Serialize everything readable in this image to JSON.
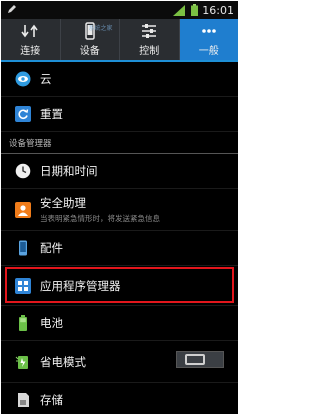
{
  "status": {
    "time": "16:01",
    "icons": [
      "edit-icon",
      "signal-icon",
      "battery-icon"
    ]
  },
  "tabs": [
    {
      "label": "连接",
      "icon": "swap-arrows-icon"
    },
    {
      "label": "设备",
      "icon": "phone-icon",
      "watermark": "系统之家"
    },
    {
      "label": "控制",
      "icon": "sliders-icon"
    },
    {
      "label": "一般",
      "icon": "more-dots-icon",
      "active": true
    }
  ],
  "accent": "#1f7ecf",
  "highlight_color": "#e2161c",
  "list": {
    "cloud": "云",
    "reset": "重置",
    "section_device_manager": "设备管理器",
    "datetime": "日期和时间",
    "safety": {
      "label": "安全助理",
      "sub": "当表明紧急情形时，将发送紧急信息"
    },
    "accessories": "配件",
    "app_manager": "应用程序管理器",
    "battery": "电池",
    "power_saving": {
      "label": "省电模式",
      "toggle": "off"
    },
    "storage": "存储"
  }
}
